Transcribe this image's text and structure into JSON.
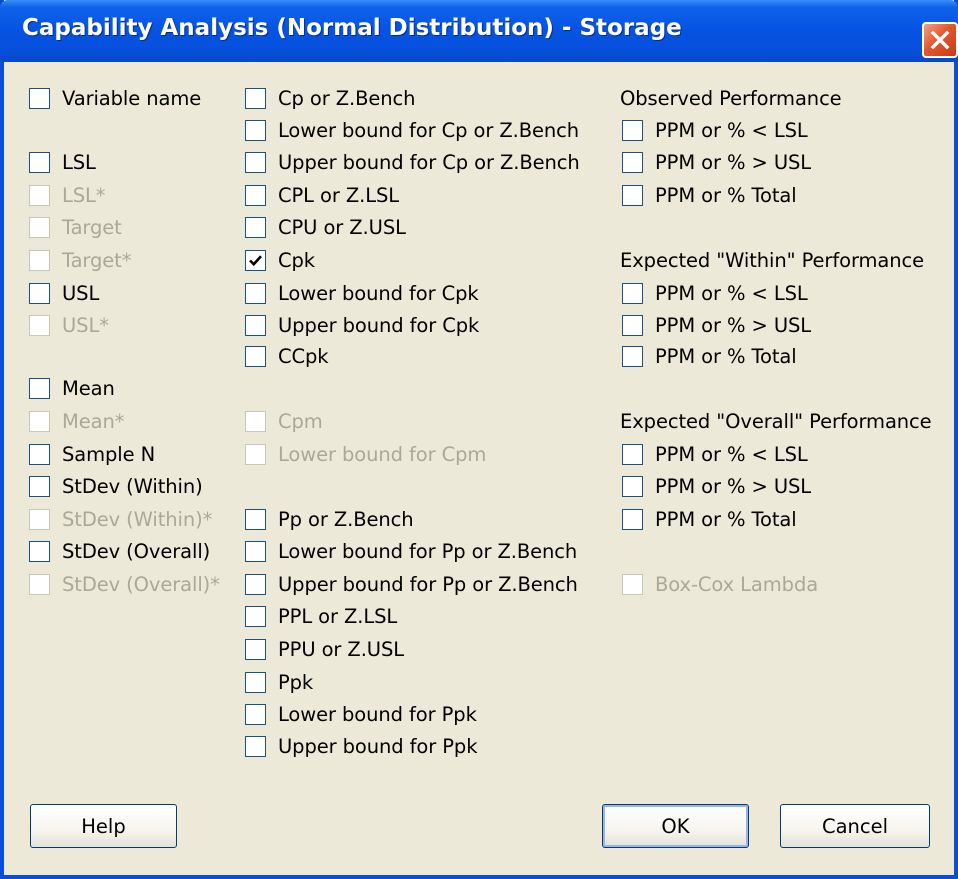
{
  "dialog": {
    "title": "Capability Analysis (Normal Distribution) - Storage",
    "close_icon": "close-x-icon"
  },
  "column1": [
    {
      "key": "variable-name",
      "label": "Variable name",
      "checked": false,
      "enabled": true
    },
    {
      "key": "lsl",
      "label": "LSL",
      "checked": false,
      "enabled": true
    },
    {
      "key": "lsl-star",
      "label": "LSL*",
      "checked": false,
      "enabled": false
    },
    {
      "key": "target",
      "label": "Target",
      "checked": false,
      "enabled": false
    },
    {
      "key": "target-star",
      "label": "Target*",
      "checked": false,
      "enabled": false
    },
    {
      "key": "usl",
      "label": "USL",
      "checked": false,
      "enabled": true
    },
    {
      "key": "usl-star",
      "label": "USL*",
      "checked": false,
      "enabled": false
    },
    {
      "key": "mean",
      "label": "Mean",
      "checked": false,
      "enabled": true
    },
    {
      "key": "mean-star",
      "label": "Mean*",
      "checked": false,
      "enabled": false
    },
    {
      "key": "sample-n",
      "label": "Sample N",
      "checked": false,
      "enabled": true
    },
    {
      "key": "stdev-within",
      "label": "StDev (Within)",
      "checked": false,
      "enabled": true
    },
    {
      "key": "stdev-within-star",
      "label": "StDev (Within)*",
      "checked": false,
      "enabled": false
    },
    {
      "key": "stdev-overall",
      "label": "StDev (Overall)",
      "checked": false,
      "enabled": true
    },
    {
      "key": "stdev-overall-star",
      "label": "StDev (Overall)*",
      "checked": false,
      "enabled": false
    }
  ],
  "column2": [
    {
      "key": "cp-zbench",
      "label": "Cp or Z.Bench",
      "checked": false,
      "enabled": true
    },
    {
      "key": "lower-cp-zbench",
      "label": "Lower bound for Cp or Z.Bench",
      "checked": false,
      "enabled": true
    },
    {
      "key": "upper-cp-zbench",
      "label": "Upper bound for Cp or Z.Bench",
      "checked": false,
      "enabled": true
    },
    {
      "key": "cpl-zlsl",
      "label": "CPL or Z.LSL",
      "checked": false,
      "enabled": true
    },
    {
      "key": "cpu-zusl",
      "label": "CPU or Z.USL",
      "checked": false,
      "enabled": true
    },
    {
      "key": "cpk",
      "label": "Cpk",
      "checked": true,
      "enabled": true
    },
    {
      "key": "lower-cpk",
      "label": "Lower bound for Cpk",
      "checked": false,
      "enabled": true
    },
    {
      "key": "upper-cpk",
      "label": "Upper bound for Cpk",
      "checked": false,
      "enabled": true
    },
    {
      "key": "ccpk",
      "label": "CCpk",
      "checked": false,
      "enabled": true
    },
    {
      "key": "cpm",
      "label": "Cpm",
      "checked": false,
      "enabled": false
    },
    {
      "key": "lower-cpm",
      "label": "Lower bound for Cpm",
      "checked": false,
      "enabled": false
    },
    {
      "key": "pp-zbench",
      "label": "Pp or Z.Bench",
      "checked": false,
      "enabled": true
    },
    {
      "key": "lower-pp-zbench",
      "label": "Lower bound for Pp or Z.Bench",
      "checked": false,
      "enabled": true
    },
    {
      "key": "upper-pp-zbench",
      "label": "Upper bound for Pp or Z.Bench",
      "checked": false,
      "enabled": true
    },
    {
      "key": "ppl-zlsl",
      "label": "PPL or Z.LSL",
      "checked": false,
      "enabled": true
    },
    {
      "key": "ppu-zusl",
      "label": "PPU or Z.USL",
      "checked": false,
      "enabled": true
    },
    {
      "key": "ppk",
      "label": "Ppk",
      "checked": false,
      "enabled": true
    },
    {
      "key": "lower-ppk",
      "label": "Lower bound for Ppk",
      "checked": false,
      "enabled": true
    },
    {
      "key": "upper-ppk",
      "label": "Upper bound for Ppk",
      "checked": false,
      "enabled": true
    }
  ],
  "column3": {
    "observed": {
      "heading": "Observed Performance",
      "items": [
        {
          "key": "obs-lt-lsl",
          "label": "PPM or % < LSL",
          "checked": false,
          "enabled": true
        },
        {
          "key": "obs-gt-usl",
          "label": "PPM or % > USL",
          "checked": false,
          "enabled": true
        },
        {
          "key": "obs-total",
          "label": "PPM or % Total",
          "checked": false,
          "enabled": true
        }
      ]
    },
    "within": {
      "heading": "Expected \"Within\" Performance",
      "items": [
        {
          "key": "within-lt-lsl",
          "label": "PPM or % < LSL",
          "checked": false,
          "enabled": true
        },
        {
          "key": "within-gt-usl",
          "label": "PPM or % > USL",
          "checked": false,
          "enabled": true
        },
        {
          "key": "within-total",
          "label": "PPM or % Total",
          "checked": false,
          "enabled": true
        }
      ]
    },
    "overall": {
      "heading": "Expected \"Overall\" Performance",
      "items": [
        {
          "key": "overall-lt-lsl",
          "label": "PPM or % < LSL",
          "checked": false,
          "enabled": true
        },
        {
          "key": "overall-gt-usl",
          "label": "PPM or % > USL",
          "checked": false,
          "enabled": true
        },
        {
          "key": "overall-total",
          "label": "PPM or % Total",
          "checked": false,
          "enabled": true
        }
      ]
    },
    "box_cox": {
      "key": "box-cox-lambda",
      "label": "Box-Cox Lambda",
      "checked": false,
      "enabled": false
    }
  },
  "buttons": {
    "help": "Help",
    "ok": "OK",
    "cancel": "Cancel"
  }
}
